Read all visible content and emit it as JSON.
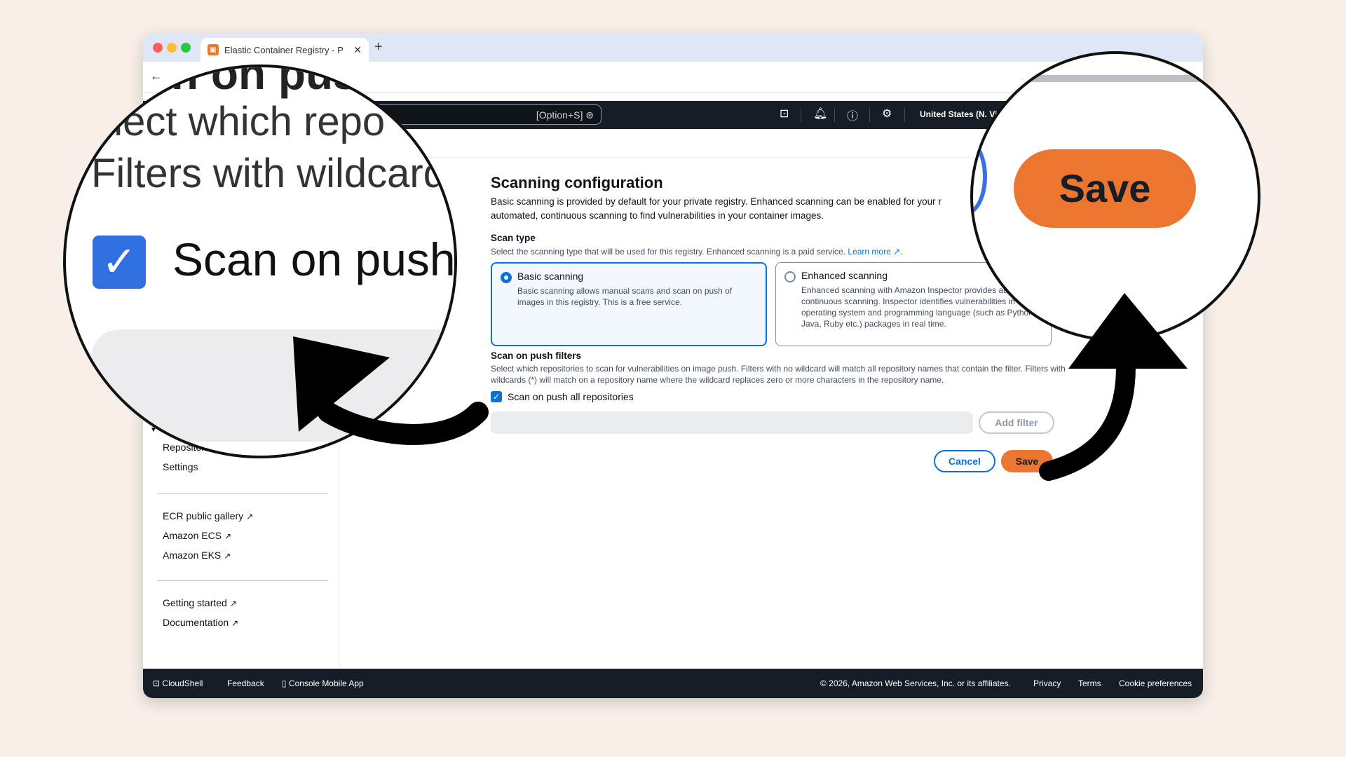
{
  "browser": {
    "tab_title": "Elastic Container Registry - P",
    "tab_close": "✕",
    "new_tab": "+",
    "back": "←"
  },
  "header": {
    "search_shortcut": "[Option+S]",
    "region": "United States (N. Vi"
  },
  "sidebar": {
    "repositories": "Repositories",
    "settings": "Settings",
    "ecr_public_gallery": "ECR public gallery",
    "amazon_ecs": "Amazon ECS",
    "amazon_eks": "Amazon EKS",
    "getting_started": "Getting started",
    "documentation": "Documentation"
  },
  "main": {
    "title": "Scanning configuration",
    "description": "Basic scanning is provided by default for your private registry. Enhanced scanning can be enabled for your r automated, continuous scanning to find vulnerabilities in your container images.",
    "scan_type_label": "Scan type",
    "scan_type_desc": "Select the scanning type that will be used for this registry. Enhanced scanning is a paid service.",
    "learn_more": "Learn more",
    "basic": {
      "title": "Basic scanning",
      "desc": "Basic scanning allows manual scans and scan on push of images in this registry. This is a free service."
    },
    "enhanced": {
      "title": "Enhanced scanning",
      "desc": "Enhanced scanning with Amazon Inspector provides automated continuous scanning. Inspector identifies vulnerabilities in both operating system and programming language (such as Python, Java, Ruby etc.) packages in real time."
    },
    "filters_label": "Scan on push filters",
    "filters_desc": "Select which repositories to scan for vulnerabilities on image push. Filters with no wildcard will match all repository names that contain the filter. Filters with wildcards (*) will match on a repository name where the wildcard replaces zero or more characters in the repository name.",
    "scan_all_label": "Scan on push all repositories",
    "add_filter": "Add filter",
    "cancel": "Cancel",
    "save": "Save"
  },
  "footer": {
    "cloudshell": "CloudShell",
    "feedback": "Feedback",
    "console_mobile_app": "Console Mobile App",
    "copyright": "© 2026, Amazon Web Services, Inc. or its affiliates.",
    "privacy": "Privacy",
    "terms": "Terms",
    "cookie_preferences": "Cookie preferences"
  },
  "zoom_left": {
    "line1": "n on pus",
    "line2": "elect which repo",
    "line3": "Filters with wildcard",
    "scan_on_push": "Scan on push"
  },
  "zoom_right": {
    "save": "Save"
  },
  "colors": {
    "accent": "#0972d3",
    "save": "#ec7630",
    "header_bg": "#161d26"
  }
}
